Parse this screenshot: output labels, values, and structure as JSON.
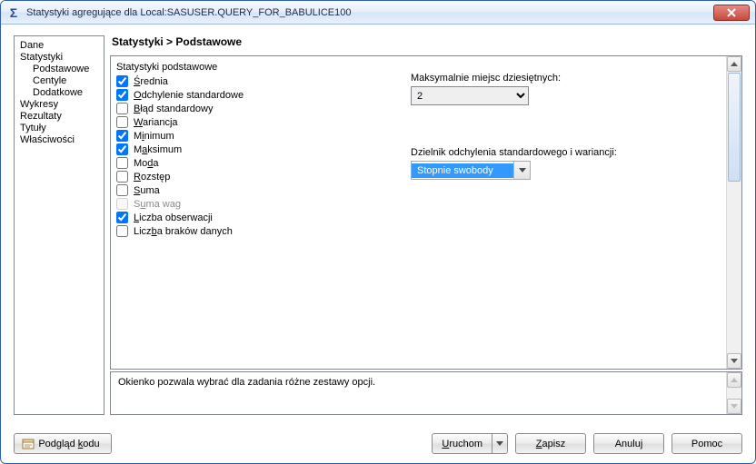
{
  "window": {
    "title": "Statystyki agregujące dla Local:SASUSER.QUERY_FOR_BABULICE100"
  },
  "nav": {
    "items": [
      {
        "label": "Dane",
        "indent": 0
      },
      {
        "label": "Statystyki",
        "indent": 0
      },
      {
        "label": "Podstawowe",
        "indent": 1
      },
      {
        "label": "Centyle",
        "indent": 1
      },
      {
        "label": "Dodatkowe",
        "indent": 1
      },
      {
        "label": "Wykresy",
        "indent": 0
      },
      {
        "label": "Rezultaty",
        "indent": 0
      },
      {
        "label": "Tytuły",
        "indent": 0
      },
      {
        "label": "Właściwości",
        "indent": 0
      }
    ]
  },
  "breadcrumb": "Statystyki > Podstawowe",
  "section": {
    "title": "Statystyki podstawowe"
  },
  "stats": [
    {
      "label_before": "",
      "u": "Ś",
      "label_after": "rednia",
      "checked": true,
      "disabled": false
    },
    {
      "label_before": "",
      "u": "O",
      "label_after": "dchylenie standardowe",
      "checked": true,
      "disabled": false
    },
    {
      "label_before": "",
      "u": "B",
      "label_after": "łąd standardowy",
      "checked": false,
      "disabled": false
    },
    {
      "label_before": "",
      "u": "W",
      "label_after": "ariancja",
      "checked": false,
      "disabled": false
    },
    {
      "label_before": "M",
      "u": "i",
      "label_after": "nimum",
      "checked": true,
      "disabled": false
    },
    {
      "label_before": "M",
      "u": "a",
      "label_after": "ksimum",
      "checked": true,
      "disabled": false
    },
    {
      "label_before": "Mo",
      "u": "d",
      "label_after": "a",
      "checked": false,
      "disabled": false
    },
    {
      "label_before": "",
      "u": "R",
      "label_after": "ozstęp",
      "checked": false,
      "disabled": false
    },
    {
      "label_before": "",
      "u": "S",
      "label_after": "uma",
      "checked": false,
      "disabled": false
    },
    {
      "label_before": "S",
      "u": "u",
      "label_after": "ma wag",
      "checked": false,
      "disabled": true
    },
    {
      "label_before": "",
      "u": "L",
      "label_after": "iczba obserwacji",
      "checked": true,
      "disabled": false
    },
    {
      "label_before": "Licz",
      "u": "b",
      "label_after": "a braków danych",
      "checked": false,
      "disabled": false
    }
  ],
  "decimals": {
    "label_before": "Ma",
    "u": "k",
    "label_after": "symalnie miejsc dziesiętnych:",
    "value": "2"
  },
  "divisor": {
    "label": "Dzielnik odchylenia standardowego i wariancji:",
    "value": "Stopnie swobody"
  },
  "description": "Okienko pozwala wybrać dla zadania różne zestawy opcji.",
  "footer": {
    "preview": {
      "before": "Podgląd ",
      "u": "k",
      "after": "odu"
    },
    "run": {
      "u": "U",
      "after": "ruchom"
    },
    "save": {
      "u": "Z",
      "after": "apisz"
    },
    "cancel": "Anuluj",
    "help": "Pomoc"
  }
}
